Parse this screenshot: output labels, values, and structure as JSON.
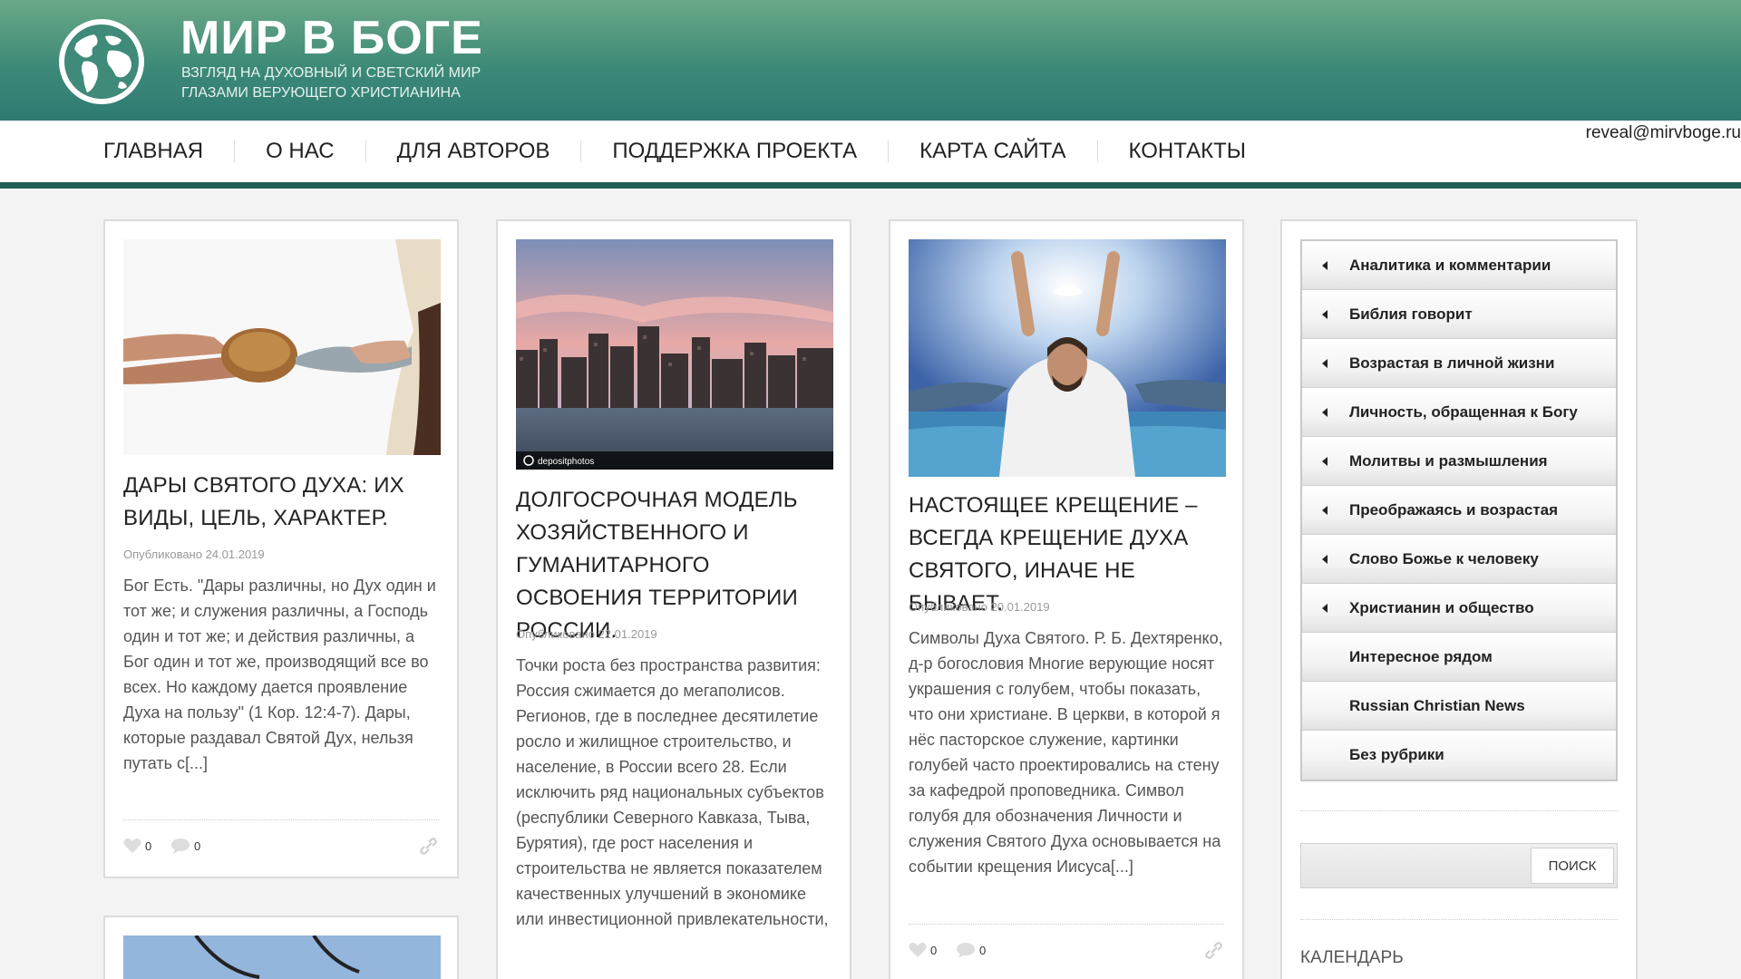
{
  "header": {
    "title": "МИР В БОГЕ",
    "tagline_line1": "ВЗГЛЯД НА ДУХОВНЫЙ И СВЕТСКИЙ МИР",
    "tagline_line2": "ГЛАЗАМИ ВЕРУЮЩЕГО ХРИСТИАНИНА",
    "logo_icon": "globe-icon",
    "email": "reveal@mirvboge.ru"
  },
  "nav": {
    "items": [
      "ГЛАВНАЯ",
      "О НАС",
      "ДЛЯ АВТОРОВ",
      "ПОДДЕРЖКА ПРОЕКТА",
      "КАРТА САЙТА",
      "КОНТАКТЫ"
    ]
  },
  "posts": [
    {
      "title": "ДАРЫ СВЯТОГО ДУХА: ИХ ВИДЫ, ЦЕЛЬ, ХАРАКТЕР.",
      "date": "Опубликовано 24.01.2019",
      "excerpt": "Бог Есть. \"Дары различны, но Дух один и тот же; и служения различны, а Господь один и тот же; и действия различны, а Бог один и тот же, производящий все во всех. Но каждому дается проявление Духа на пользу\" (1 Кор. 12:4-7). Дары, которые раздавал Святой Дух, нельзя путать с[...]",
      "likes": "0",
      "comments": "0"
    },
    {
      "title": "ДОЛГОСРОЧНАЯ МОДЕЛЬ ХОЗЯЙСТВЕННОГО И ГУМАНИТАРНОГО ОСВОЕНИЯ ТЕРРИТОРИИ РОССИИ.",
      "date": "Опубликовано 22.01.2019",
      "excerpt": "Точки роста без пространства развития: Россия сжимается до мегаполисов. Регионов, где в последнее десятилетие росло и жилищное строительство, и население, в России всего 28. Если исключить ряд национальных субъектов (республики Северного Кавказа, Тыва, Бурятия), где рост населения и строительства не является показателем качественных улучшений в экономике или инвестиционной привлекательности,",
      "image_caption": "depositphotos"
    },
    {
      "title": "НАСТОЯЩЕЕ КРЕЩЕНИЕ – ВСЕГДА КРЕЩЕНИЕ ДУХА СВЯТОГО, ИНАЧЕ НЕ БЫВАЕТ.",
      "date": "Опубликовано 20.01.2019",
      "excerpt": "Символы Духа Святого. Р. Б. Дехтяренко, д-р богословия Многие верующие носят украшения с голубем, чтобы показать, что они христиане. В церкви, в которой я нёс пасторское служение, картинки голубей часто проектировались на стену за кафедрой проповедника. Символ голубя для обозначения Личности и служения Святого Духа основывается на событии крещения Иисуса[...]",
      "likes": "0",
      "comments": "0"
    }
  ],
  "sidebar": {
    "categories": [
      {
        "label": "Аналитика и комментарии",
        "arrow": true
      },
      {
        "label": "Библия говорит",
        "arrow": true
      },
      {
        "label": "Возрастая в личной жизни",
        "arrow": true
      },
      {
        "label": "Личность, обращенная к Богу",
        "arrow": true
      },
      {
        "label": "Молитвы и размышления",
        "arrow": true
      },
      {
        "label": "Преображаясь и возрастая",
        "arrow": true
      },
      {
        "label": "Слово Божье к человеку",
        "arrow": true
      },
      {
        "label": "Христианин и общество",
        "arrow": true
      },
      {
        "label": "Интересное рядом",
        "arrow": false
      },
      {
        "label": "Russian Christian News",
        "arrow": false
      },
      {
        "label": "Без рубрики",
        "arrow": false
      }
    ],
    "search": {
      "value": "",
      "button_label": "ПОИСК"
    },
    "calendar_title": "КАЛЕНДАРЬ"
  },
  "colors": {
    "header_top": "#6aa886",
    "header_bottom": "#2e7a72",
    "nav_bar": "#1f5e57"
  }
}
